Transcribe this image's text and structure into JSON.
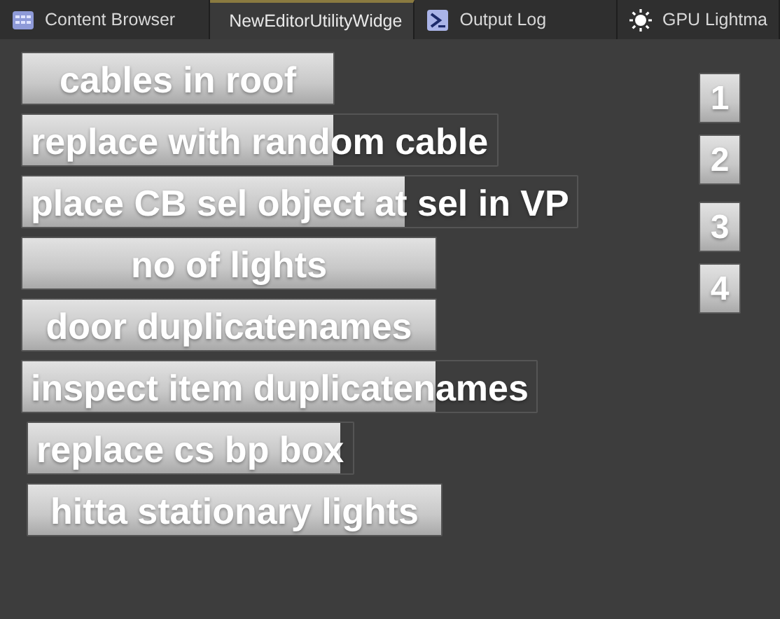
{
  "tabs": [
    {
      "label": "Content Browser",
      "kind": "grid",
      "selected": false
    },
    {
      "label": "NewEditorUtilityWidge",
      "kind": "none",
      "selected": true
    },
    {
      "label": "Output Log",
      "kind": "terminal",
      "selected": false
    },
    {
      "label": "GPU Lightma",
      "kind": "sun",
      "selected": false
    }
  ],
  "buttons": [
    "cables in roof",
    "replace with random cable",
    "place CB sel object at sel in VP",
    "no of lights",
    "door duplicatenames",
    "inspect item duplicatenames",
    "replace cs bp box",
    "hitta stationary lights"
  ],
  "number_buttons": [
    "1",
    "2",
    "3",
    "4"
  ]
}
